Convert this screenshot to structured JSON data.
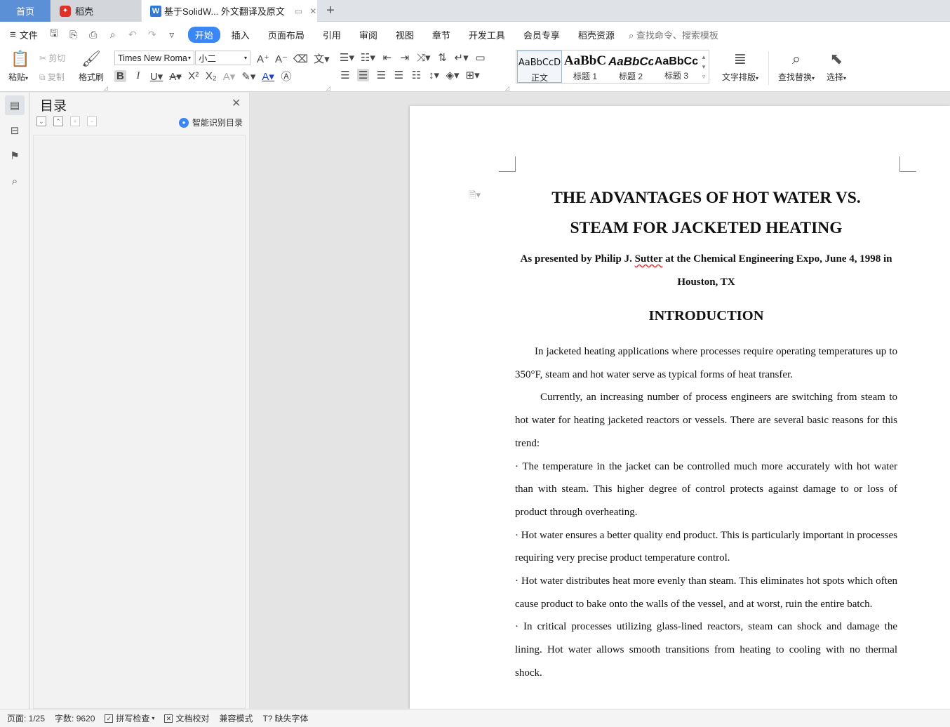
{
  "tabs": {
    "home": "首页",
    "daoke": "稻壳",
    "document": "基于SolidW... 外文翻译及原文"
  },
  "menu": {
    "file": "文件",
    "items": [
      "开始",
      "插入",
      "页面布局",
      "引用",
      "审阅",
      "视图",
      "章节",
      "开发工具",
      "会员专享",
      "稻壳资源"
    ],
    "search_placeholder": "查找命令、搜索模板"
  },
  "ribbon": {
    "paste": "粘贴",
    "cut": "剪切",
    "copy": "复制",
    "format_painter": "格式刷",
    "font_name": "Times New Roma",
    "font_size": "小二",
    "styles": [
      {
        "sample": "AaBbCcD",
        "name": "正文"
      },
      {
        "sample": "AaBbC",
        "name": "标题 1"
      },
      {
        "sample": "AaBbCc",
        "name": "标题 2"
      },
      {
        "sample": "AaBbCc",
        "name": "标题 3"
      }
    ],
    "text_layout": "文字排版",
    "find_replace": "查找替换",
    "select": "选择"
  },
  "toc": {
    "title": "目录",
    "smart": "智能识别目录"
  },
  "document": {
    "title_line1": "THE ADVANTAGES OF HOT WATER VS.",
    "title_line2": "STEAM FOR JACKETED HEATING",
    "subtitle_pre": "As presented by Philip J. ",
    "subtitle_name": "Sutter",
    "subtitle_post": " at the Chemical Engineering Expo, June 4, 1998 in Houston, TX",
    "heading": "INTRODUCTION",
    "p1": "In jacketed heating applications where processes require operating temperatures up to 350°F, steam and hot water serve as typical forms of heat transfer.",
    "p2": "Currently, an increasing number of process engineers are switching from steam to hot water for heating jacketed reactors or vessels. There are several basic reasons for this trend:",
    "b1": "· The temperature in the jacket can be controlled much more accurately with hot water than with steam. This higher degree of control protects against damage to or loss of product through overheating.",
    "b2": "· Hot water ensures a better quality end product. This is particularly important in processes requiring very precise product temperature control.",
    "b3": "· Hot water distributes heat more evenly than steam. This eliminates hot spots which often cause product to bake onto the walls of the vessel, and at worst, ruin the entire batch.",
    "b4": "· In critical processes utilizing glass-lined reactors, steam can shock and damage the lining. Hot water allows smooth transitions from heating to cooling with no thermal shock."
  },
  "status": {
    "page": "页面: 1/25",
    "words": "字数: 9620",
    "spell": "拼写检查",
    "proof": "文档校对",
    "compat": "兼容模式",
    "missing_font": "缺失字体"
  }
}
